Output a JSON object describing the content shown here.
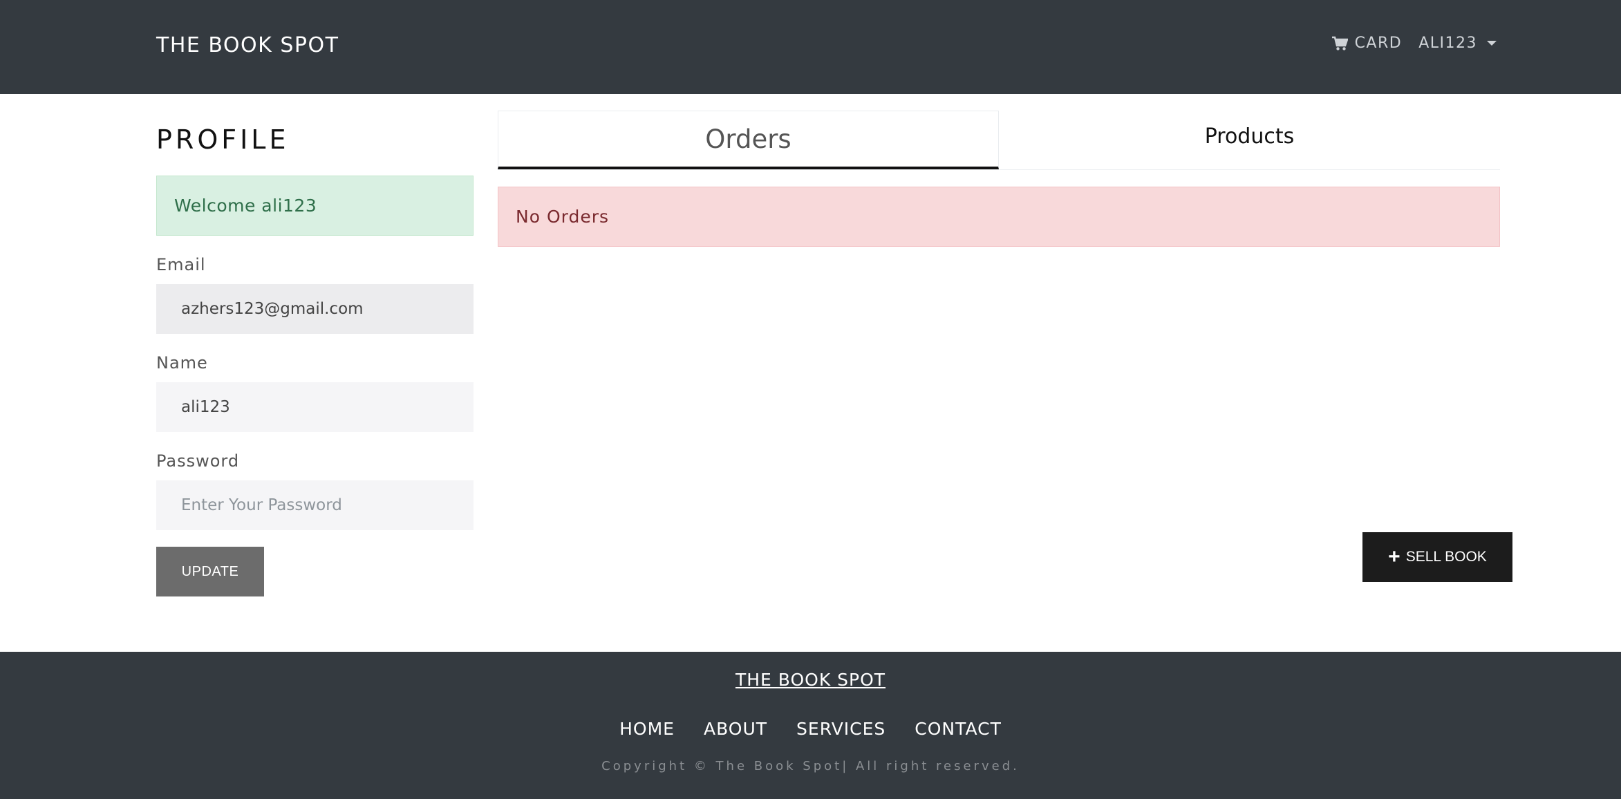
{
  "header": {
    "brand": "THE BOOK SPOT",
    "cart_label": "CARD",
    "user_label": "ALI123"
  },
  "profile": {
    "title": "PROFILE",
    "welcome": "Welcome ali123",
    "email_label": "Email",
    "email_value": "azhers123@gmail.com",
    "name_label": "Name",
    "name_value": "ali123",
    "password_label": "Password",
    "password_placeholder": "Enter Your Password",
    "update_label": "UPDATE"
  },
  "tabs": [
    {
      "label": "Orders",
      "active": true
    },
    {
      "label": "Products",
      "active": false
    }
  ],
  "orders": {
    "empty_message": "No Orders"
  },
  "sell_button": {
    "label": "SELL BOOK"
  },
  "footer": {
    "brand": "THE BOOK SPOT",
    "links": [
      "HOME",
      "ABOUT",
      "SERVICES",
      "CONTACT"
    ],
    "copyright": "Copyright © The Book Spot| All right reserved."
  },
  "colors": {
    "header_bg": "#343a40",
    "success_bg": "#d9f0e2",
    "danger_bg": "#f8d9da",
    "button_dark": "#1c1c1c",
    "button_gray": "#6c6c6c"
  },
  "icons": {
    "cart": "shopping-cart-icon",
    "caret": "caret-down-icon",
    "plus": "plus-icon"
  }
}
